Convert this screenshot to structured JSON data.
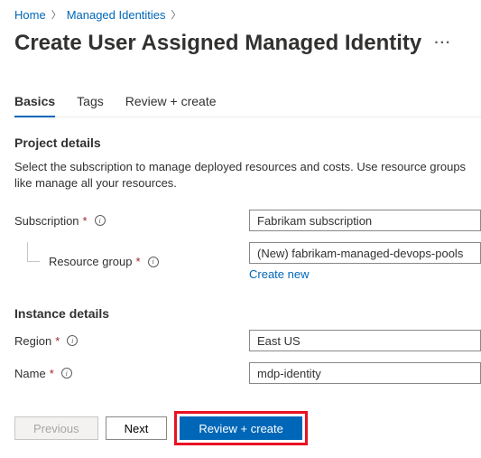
{
  "breadcrumb": {
    "home": "Home",
    "managed_identities": "Managed Identities"
  },
  "page_title": "Create User Assigned Managed Identity",
  "tabs": {
    "basics": "Basics",
    "tags": "Tags",
    "review_create": "Review + create"
  },
  "project_details": {
    "heading": "Project details",
    "description": "Select the subscription to manage deployed resources and costs. Use resource groups like manage all your resources.",
    "subscription_label": "Subscription",
    "subscription_value": "Fabrikam subscription",
    "resource_group_label": "Resource group",
    "resource_group_value": "(New) fabrikam-managed-devops-pools",
    "create_new_link": "Create new"
  },
  "instance_details": {
    "heading": "Instance details",
    "region_label": "Region",
    "region_value": "East US",
    "name_label": "Name",
    "name_value": "mdp-identity"
  },
  "footer": {
    "previous": "Previous",
    "next": "Next",
    "review_create": "Review + create"
  }
}
